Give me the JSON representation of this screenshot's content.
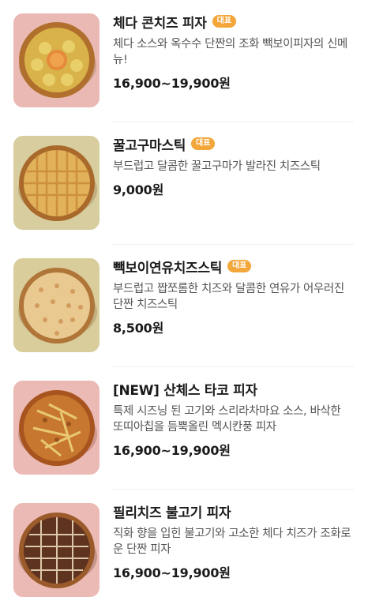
{
  "menu_items": [
    {
      "name": "체다 콘치즈 피자",
      "badge": "대표",
      "description": "체다 소스와 옥수수 단짠의 조화 빽보이피자의 신메뉴!",
      "price": "16,900~19,900원",
      "bg_color": "#eab9b3",
      "icon": "pizza-corn-cheese-image"
    },
    {
      "name": "꿀고구마스틱",
      "badge": "대표",
      "description": "부드럽고 달콤한 꿀고구마가 발라진 치즈스틱",
      "price": "9,000원",
      "bg_color": "#d7cd9e",
      "icon": "pizza-sweet-potato-stick-image"
    },
    {
      "name": "빽보이연유치즈스틱",
      "badge": "대표",
      "description": "부드럽고 짭쪼롬한 치즈와 달콤한 연유가 어우러진 단짠 치즈스틱",
      "price": "8,500원",
      "bg_color": "#d9cd9c",
      "icon": "pizza-condensed-milk-stick-image"
    },
    {
      "name": "[NEW] 산체스 타코 피자",
      "badge": "",
      "description": "특제 시즈닝 된 고기와 스리라차마요 소스, 바삭한 또띠아칩을 듬뿍올린 멕시칸풍 피자",
      "price": "16,900~19,900원",
      "bg_color": "#ebbab4",
      "icon": "pizza-taco-image"
    },
    {
      "name": "필리치즈 불고기 피자",
      "badge": "",
      "description": "직화 향을 입힌 불고기와 고소한 체다 치즈가 조화로운 단짠 피자",
      "price": "16,900~19,900원",
      "bg_color": "#ebbab4",
      "icon": "pizza-bulgogi-image"
    }
  ]
}
